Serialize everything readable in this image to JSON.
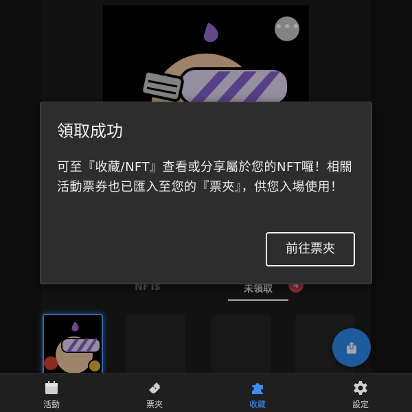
{
  "nft_hero": {
    "more_icon": "more-horizontal-icon",
    "more_label": "•••"
  },
  "tabs": [
    {
      "label": "NFTs"
    },
    {
      "label": "未領取",
      "badge": "4"
    }
  ],
  "fab": {
    "icon": "share-upload-icon"
  },
  "bottom_nav": [
    {
      "label": "活動",
      "icon": "calendar-icon"
    },
    {
      "label": "票夾",
      "icon": "ticket-icon"
    },
    {
      "label": "收藏",
      "icon": "puzzle-icon",
      "active": true
    },
    {
      "label": "設定",
      "icon": "gear-icon"
    }
  ],
  "dialog": {
    "title": "領取成功",
    "body": "可至『收藏/NFT』查看或分享屬於您的NFT囉！相關活動票券也已匯入至您的『票夾』，供您入場使用！",
    "button_label": "前往票夾"
  },
  "colors": {
    "accent": "#3d8ef0",
    "fab": "#2f8bf0",
    "badge": "#e8495f",
    "dialog_bg": "#2d2d2d",
    "background": "#141414"
  }
}
